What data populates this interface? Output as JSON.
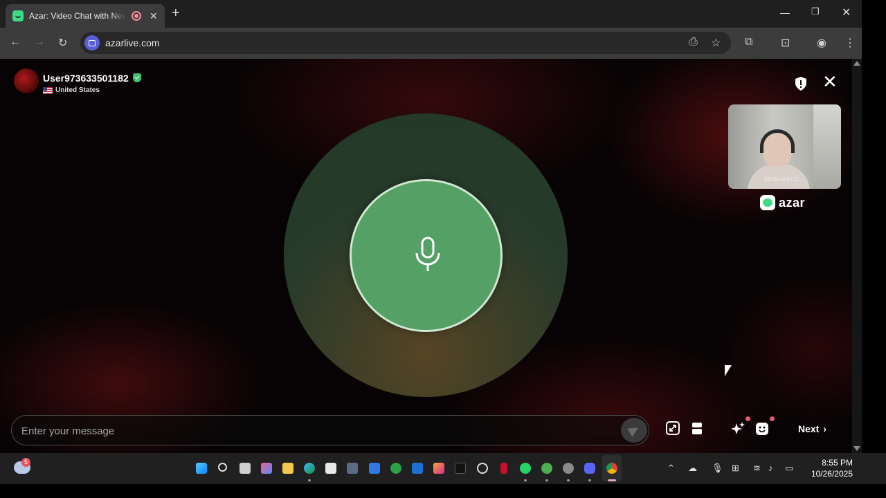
{
  "browser": {
    "tab_title": "Azar: Video Chat with New Friends",
    "url": "azarlive.com"
  },
  "partner": {
    "username": "User973633501182",
    "country": "United States"
  },
  "self_view": {
    "watermark": "25VAmdeDQZ"
  },
  "brand": {
    "logo_text": "azar"
  },
  "chat": {
    "placeholder": "Enter your message",
    "next_label": "Next"
  },
  "taskbar": {
    "weather_badge": "5",
    "time": "8:55 PM",
    "date": "10/26/2025"
  },
  "colors": {
    "accent_green": "#55a064",
    "brand_green": "#3ddc84",
    "notification_dot": "#e85a6a"
  }
}
